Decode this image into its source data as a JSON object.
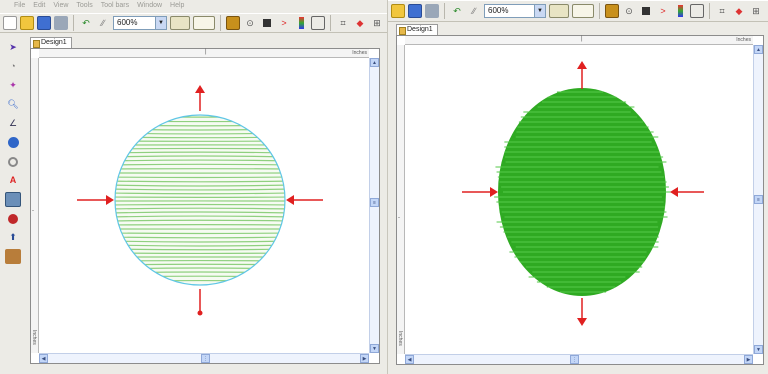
{
  "left_window": {
    "menu": [
      "File",
      "Edit",
      "View",
      "Tools",
      "Tool bars",
      "Window",
      "Help"
    ],
    "zoom": "600%",
    "tab": "Design1",
    "ruler_unit_top": "Inches",
    "ruler_unit_left": "Inches"
  },
  "right_window": {
    "zoom": "600%",
    "tab": "Design1",
    "ruler_unit_top": "Inches",
    "ruler_unit_left": "Inches"
  },
  "colors": {
    "stitch_light": "#8fd07f",
    "stitch_dark": "#2faa22",
    "outline": "#5fc6e6",
    "arrow": "#e02020"
  },
  "icons": {
    "toolbar": [
      "new-icon",
      "open-icon",
      "save-icon",
      "print-icon",
      "undo-icon",
      "redo-icon",
      "zoom-dropdown",
      "design-view-icon",
      "stitch-list-icon",
      "pin-icon",
      "stop-icon",
      "play-icon",
      "color-bar-icon",
      "hoop-icon",
      "grid-icon",
      "color-palette-icon",
      "fit-icon"
    ],
    "left_tools": [
      "pointer-icon",
      "shapes-icon",
      "fill-icon",
      "zoom-tool-icon",
      "line-icon",
      "circle-icon",
      "ellipse-icon",
      "text-icon",
      "image-icon",
      "paint-icon",
      "punch-icon",
      "wrench-icon"
    ]
  }
}
